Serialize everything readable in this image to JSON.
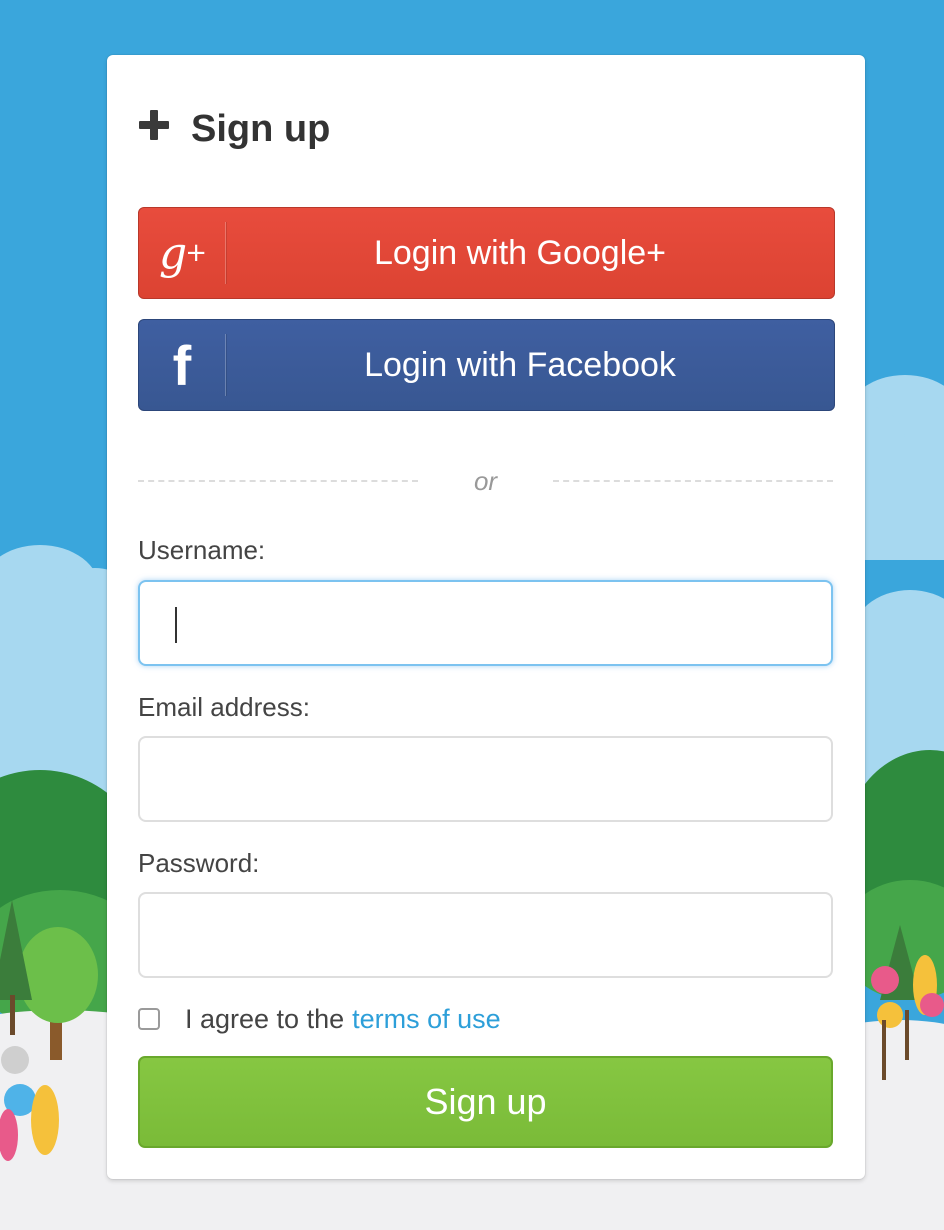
{
  "form": {
    "title": "Sign up",
    "google_label": "Login with Google+",
    "google_icon_text": "g",
    "google_icon_plus": "+",
    "facebook_label": "Login with Facebook",
    "facebook_icon_text": "f",
    "divider_text": "or",
    "username_label": "Username:",
    "username_value": "",
    "email_label": "Email address:",
    "email_value": "",
    "password_label": "Password:",
    "password_value": "",
    "agree_text": "I agree to the",
    "terms_link": "terms of use",
    "agree_checked": false,
    "submit_label": "Sign up"
  },
  "icons": {
    "title": "plus-icon",
    "google": "google-plus-icon",
    "facebook": "facebook-icon"
  },
  "colors": {
    "background": "#3aa6dc",
    "google": "#e04a39",
    "facebook": "#3c5b9b",
    "submit": "#80c23e",
    "link": "#2d9fd9",
    "focus": "#7cc3f0"
  }
}
